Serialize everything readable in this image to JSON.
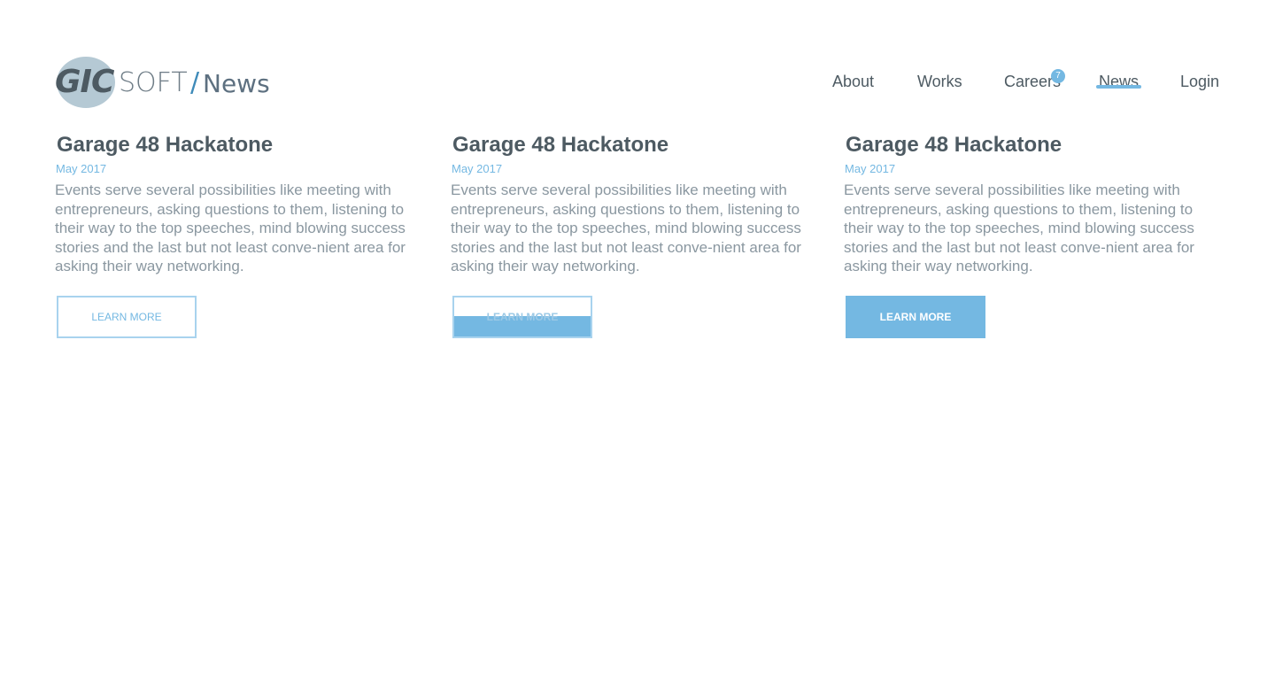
{
  "logo": {
    "brand_mark": "GIC",
    "brand_word": "SOFT",
    "separator": "/",
    "section": "News"
  },
  "nav": {
    "items": [
      {
        "label": "About"
      },
      {
        "label": "Works"
      },
      {
        "label": "Careers",
        "badge": "7"
      },
      {
        "label": "News",
        "active": true
      },
      {
        "label": "Login"
      }
    ]
  },
  "articles": [
    {
      "title": "Garage 48 Hackatone",
      "date": "May 2017",
      "body": "Events serve several possibilities like meeting with entrepreneurs, asking questions to them, listening to their way to the top speeches, mind blowing success stories and the last but not least conve-nient area for asking their way networking.",
      "button": "LEARN MORE",
      "button_state": "default"
    },
    {
      "title": "Garage 48 Hackatone",
      "date": "May 2017",
      "body": "Events serve several possibilities like meeting with entrepreneurs, asking questions to them, listening to their way to the top speeches, mind blowing success stories and the last but not least conve-nient area for asking their way networking.",
      "button": "LEARN MORE",
      "button_state": "transition"
    },
    {
      "title": "Garage 48 Hackatone",
      "date": "May 2017",
      "body": "Events serve several possibilities like meeting with entrepreneurs, asking questions to them, listening to their way to the top speeches, mind blowing success stories and the last but not least conve-nient area for asking their way networking.",
      "button": "LEARN MORE",
      "button_state": "hover"
    }
  ],
  "colors": {
    "accent": "#74b8e2",
    "heading": "#4d5a62",
    "body_text": "#8a97a0",
    "background": "#ffffff"
  }
}
